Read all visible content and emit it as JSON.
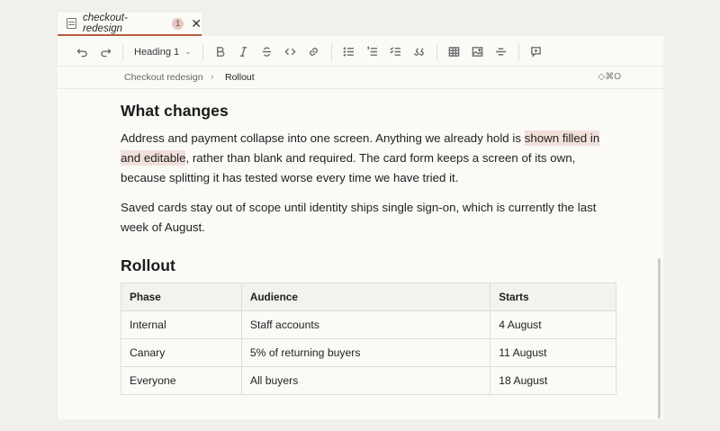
{
  "tab": {
    "title": "checkout-redesign",
    "badge": "1",
    "close": "✕"
  },
  "toolbar": {
    "heading_select": "Heading 1",
    "items": [
      "undo-icon",
      "redo-icon",
      "bold-icon",
      "italic-icon",
      "strikethrough-icon",
      "code-icon",
      "link-icon",
      "bullet-list-icon",
      "numbered-list-icon",
      "checklist-icon",
      "quote-icon",
      "table-icon",
      "image-icon",
      "divider-icon",
      "comment-icon"
    ]
  },
  "breadcrumb": {
    "parent": "Checkout redesign",
    "separator": "›",
    "current": "Rollout",
    "shortcut": "◇⌘O"
  },
  "doc": {
    "h1": "What changes",
    "p1": {
      "before": "Address and payment collapse into one screen. Anything we already hold is ",
      "highlight": "shown filled in and editable",
      "after": ", rather than blank and required. The card form keeps a screen of its own, because splitting it has tested worse every time we have tried it."
    },
    "p2": "Saved cards stay out of scope until identity ships single sign-on, which is currently the last week of August.",
    "h2": "Rollout",
    "table": {
      "headers": [
        "Phase",
        "Audience",
        "Starts"
      ],
      "rows": [
        [
          "Internal",
          "Staff accounts",
          "4 August"
        ],
        [
          "Canary",
          "5% of returning buyers",
          "11 August"
        ],
        [
          "Everyone",
          "All buyers",
          "18 August"
        ]
      ]
    }
  },
  "colors": {
    "accent": "#b05d3b",
    "highlight": "#f1e0da",
    "badge": "#e3c9c0"
  }
}
